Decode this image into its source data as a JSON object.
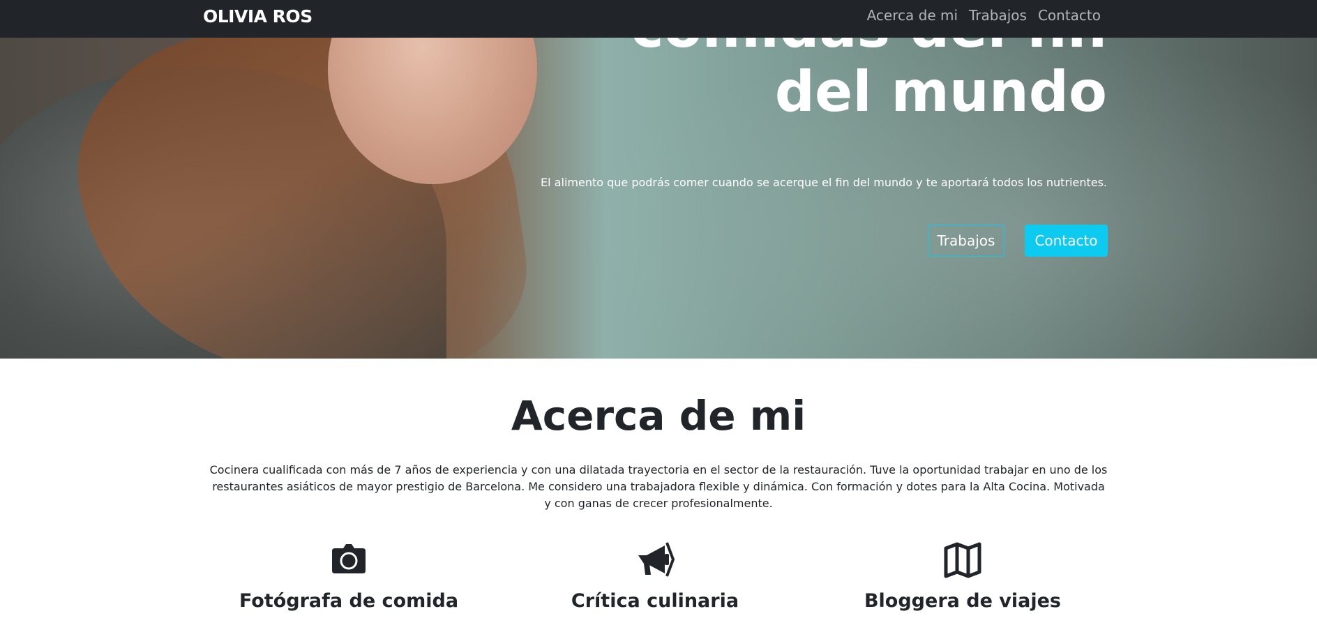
{
  "nav": {
    "brand": "OLIVIA ROS",
    "links": [
      "Acerca de mi",
      "Trabajos",
      "Contacto"
    ]
  },
  "hero": {
    "title_line1": "comidas del fin",
    "title_line2": "del mundo",
    "subtitle": "El alimento que podrás comer cuando se acerque el fin del mundo y te aportará todos los nutrientes.",
    "button_outline": "Trabajos",
    "button_fill": "Contacto",
    "accent_color": "#0dcaf0"
  },
  "about": {
    "title": "Acerca de mi",
    "text": "Cocinera cualificada con más de 7 años de experiencia y con una dilatada trayectoria en el sector de la restauración. Tuve la oportunidad trabajar en uno de los restaurantes asiáticos de mayor prestigio de Barcelona. Me considero una trabajadora flexible y dinámica. Con formación y dotes para la Alta Cocina. Motivada y con ganas de crecer profesionalmente.",
    "features": [
      {
        "icon": "camera-icon",
        "label": "Fotógrafa de comida"
      },
      {
        "icon": "megaphone-icon",
        "label": "Crítica culinaria"
      },
      {
        "icon": "map-icon",
        "label": "Bloggera de viajes"
      }
    ]
  }
}
